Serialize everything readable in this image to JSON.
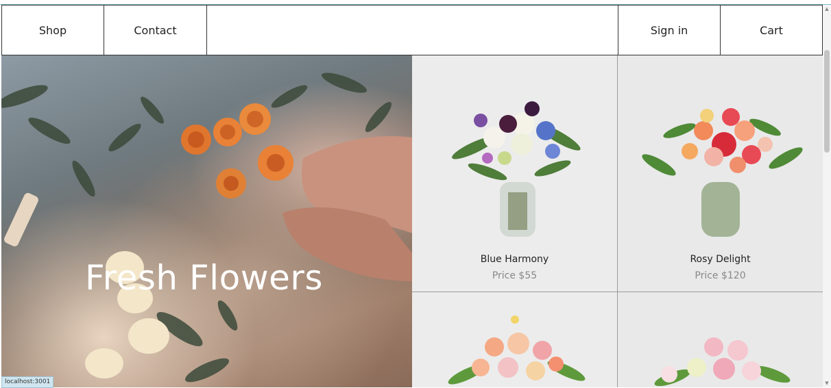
{
  "nav": {
    "shop": "Shop",
    "contact": "Contact",
    "signin": "Sign in",
    "cart": "Cart"
  },
  "hero": {
    "title": "Fresh Flowers"
  },
  "products": [
    {
      "name": "Blue Harmony",
      "price": "Price $55"
    },
    {
      "name": "Rosy Delight",
      "price": "Price $120"
    },
    {
      "name": "",
      "price": ""
    },
    {
      "name": "",
      "price": ""
    }
  ],
  "status_bar": {
    "url": "localhost:3001"
  },
  "colors": {
    "border": "#333333",
    "card_bg": "#ececec",
    "price_text": "#888888"
  }
}
